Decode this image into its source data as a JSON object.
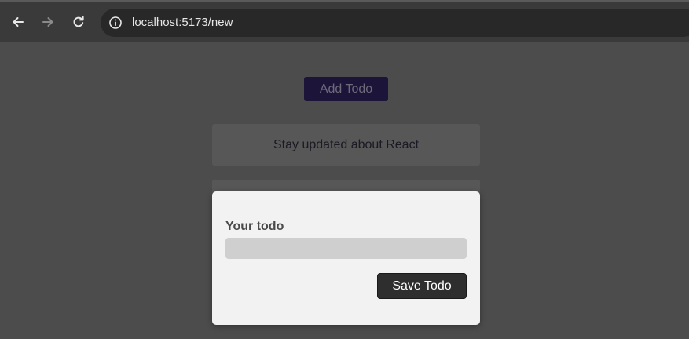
{
  "browser": {
    "url": "localhost:5173/new",
    "icons": {
      "back": "arrow-left-icon",
      "forward": "arrow-right-icon",
      "reload": "reload-icon",
      "site_info": "info-icon"
    }
  },
  "page": {
    "add_button_label": "Add Todo",
    "todos": [
      {
        "text": "Stay updated about React"
      }
    ]
  },
  "modal": {
    "label": "Your todo",
    "input_value": "",
    "input_placeholder": "",
    "save_button_label": "Save Todo"
  },
  "colors": {
    "overlay_background": "#4c4c4c",
    "add_button": "#1d1539",
    "modal_background": "#f2f2f2",
    "input_background": "#cfcfcf",
    "save_button": "#2e2e2e"
  }
}
